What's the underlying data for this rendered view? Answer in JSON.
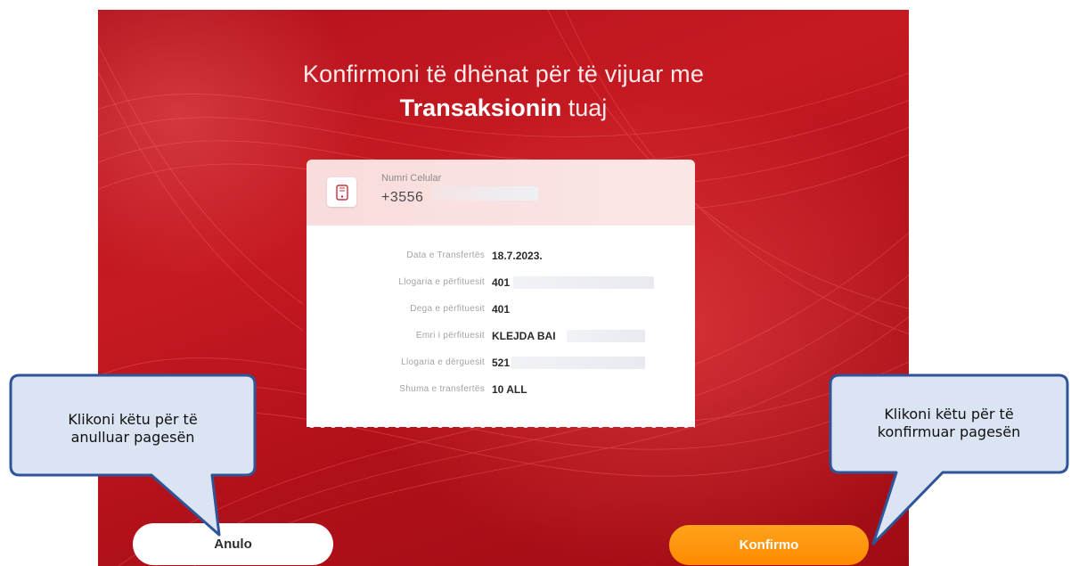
{
  "header": {
    "title_line1": "Konfirmoni të dhënat për të vijuar me",
    "title_bold": "Transaksionin",
    "title_suffix": "tuaj"
  },
  "card": {
    "phone_label": "Numri Celular",
    "phone_value": "+3556",
    "rows": [
      {
        "label": "Data e Transfertës",
        "value": "18.7.2023."
      },
      {
        "label": "Llogaria e përfituesit",
        "value": "401"
      },
      {
        "label": "Dega e përfituesit",
        "value": "401"
      },
      {
        "label": "Emri i përfituesit",
        "value": "KLEJDA BAI"
      },
      {
        "label": "Llogaria e dërguesit",
        "value": "521"
      },
      {
        "label": "Shuma e transfertës",
        "value": "10 ALL"
      }
    ]
  },
  "buttons": {
    "cancel_label": "Anulo",
    "confirm_label": "Konfirmo"
  },
  "callouts": {
    "left_line1": "Klikoni këtu për të",
    "left_line2": "anulluar pagesën",
    "right_line1": "Klikoni këtu për të",
    "right_line2": "konfirmuar pagesën"
  },
  "icons": {
    "phone": "phone-icon"
  },
  "colors": {
    "background_red": "#b4121c",
    "confirm_orange": "#ff8a00",
    "callout_fill": "#dbe4f2",
    "callout_border": "#2f5597"
  }
}
